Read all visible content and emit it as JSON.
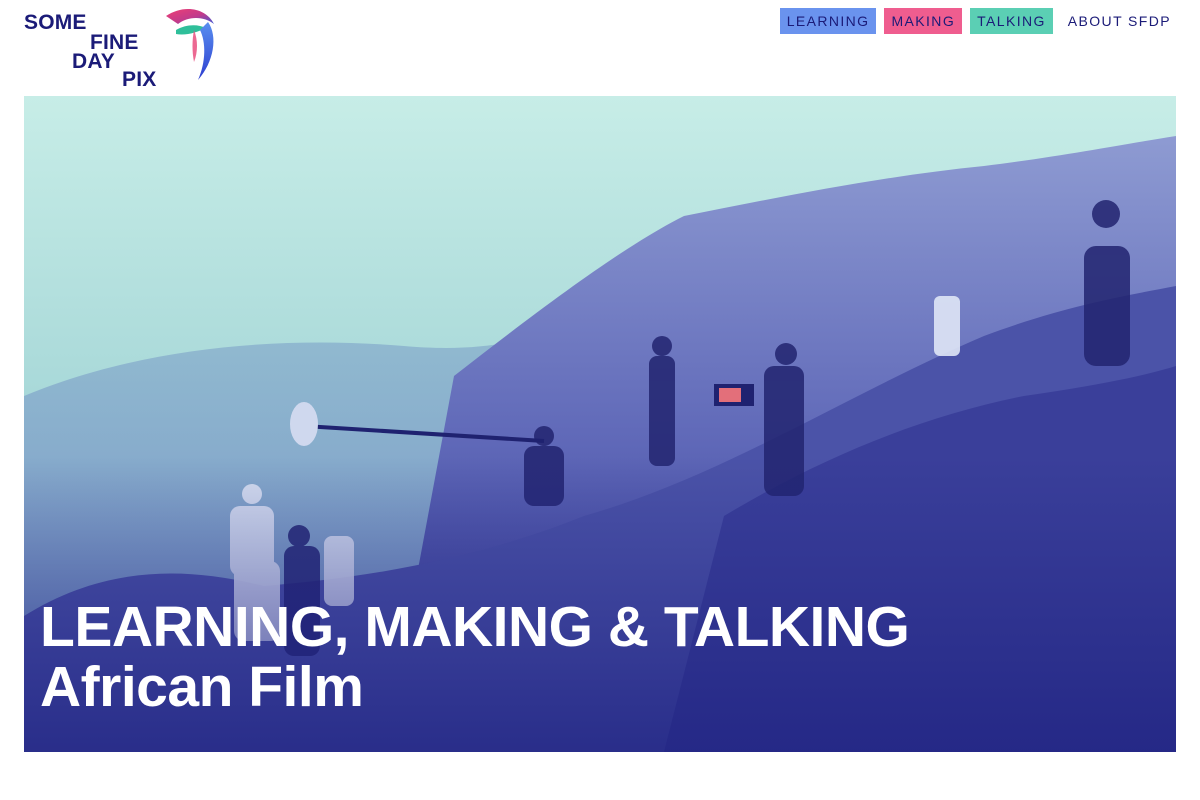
{
  "logo": {
    "line1": "SOME",
    "line2": "FINE",
    "line3": "DAY",
    "line4": "PIX",
    "icon": "swallow-bird-icon"
  },
  "nav": {
    "items": [
      {
        "label": "LEARNING",
        "color": "#6a93ee"
      },
      {
        "label": "MAKING",
        "color": "#ef5d8f"
      },
      {
        "label": "TALKING",
        "color": "#5bcfb4"
      },
      {
        "label": "ABOUT SFDP",
        "color": ""
      }
    ]
  },
  "hero": {
    "title_line1": "LEARNING, MAKING & TALKING",
    "title_line2": "African Film",
    "image_subject": "film crew shooting on a hillside above a valley",
    "tint_top": "#bfe9e3",
    "tint_bottom": "#2a2f8e"
  }
}
